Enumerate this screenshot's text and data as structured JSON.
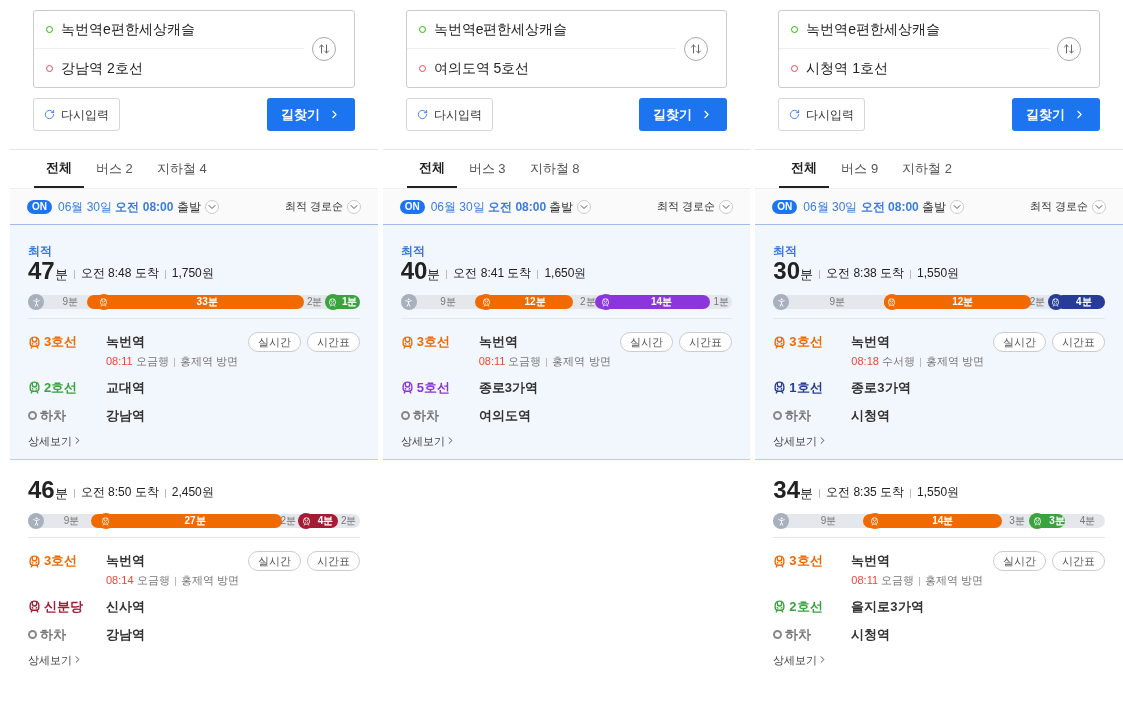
{
  "panels": [
    {
      "origin": "녹번역e편한세상캐슬",
      "destination": "강남역 2호선",
      "reset": "다시입력",
      "search": "길찾기",
      "tabs": [
        {
          "label": "전체",
          "selected": true
        },
        {
          "label": "버스 2",
          "selected": false
        },
        {
          "label": "지하철 4",
          "selected": false
        }
      ],
      "filter": {
        "badge": "ON",
        "date": "06월 30일",
        "time": "오전 08:00",
        "suffix": "출발",
        "sort": "최적 경로순"
      },
      "routes": [
        {
          "selected": true,
          "badge": "최적",
          "minutes": "47",
          "unit": "분",
          "arrival": "오전 8:48 도착",
          "fare": "1,750원",
          "segments": [
            {
              "kind": "walk",
              "label": "9분"
            },
            {
              "kind": "ride",
              "color": "#f06a00",
              "label": "33분"
            },
            {
              "kind": "walk",
              "label": "2분"
            },
            {
              "kind": "ride",
              "color": "#3aa33e",
              "label": "1분"
            }
          ],
          "steps": [
            {
              "kind": "ride",
              "color": "#f06a00",
              "line": "3호선",
              "station": "녹번역",
              "buttons": [
                "실시간",
                "시간표"
              ],
              "time": "08:11",
              "bound": "오금행",
              "direction": "홍제역 방면"
            },
            {
              "kind": "ride",
              "color": "#3aa33e",
              "line": "2호선",
              "station": "교대역"
            },
            {
              "kind": "alight",
              "line": "하차",
              "station": "강남역"
            }
          ],
          "more": "상세보기"
        },
        {
          "selected": false,
          "minutes": "46",
          "unit": "분",
          "arrival": "오전 8:50 도착",
          "fare": "2,450원",
          "segments": [
            {
              "kind": "walk",
              "label": "9분"
            },
            {
              "kind": "ride",
              "color": "#f06a00",
              "label": "27분"
            },
            {
              "kind": "walk",
              "label": "2분"
            },
            {
              "kind": "ride",
              "color": "#a31c34",
              "label": "4분"
            },
            {
              "kind": "walk",
              "label": "2분"
            }
          ],
          "steps": [
            {
              "kind": "ride",
              "color": "#f06a00",
              "line": "3호선",
              "station": "녹번역",
              "buttons": [
                "실시간",
                "시간표"
              ],
              "time": "08:14",
              "bound": "오금행",
              "direction": "홍제역 방면"
            },
            {
              "kind": "ride",
              "color": "#a31c34",
              "line": "신분당",
              "station": "신사역"
            },
            {
              "kind": "alight",
              "line": "하차",
              "station": "강남역"
            }
          ],
          "more": "상세보기"
        }
      ]
    },
    {
      "origin": "녹번역e편한세상캐슬",
      "destination": "여의도역 5호선",
      "reset": "다시입력",
      "search": "길찾기",
      "tabs": [
        {
          "label": "전체",
          "selected": true
        },
        {
          "label": "버스 3",
          "selected": false
        },
        {
          "label": "지하철 8",
          "selected": false
        }
      ],
      "filter": {
        "badge": "ON",
        "date": "06월 30일",
        "time": "오전 08:00",
        "suffix": "출발",
        "sort": "최적 경로순"
      },
      "routes": [
        {
          "selected": true,
          "badge": "최적",
          "minutes": "40",
          "unit": "분",
          "arrival": "오전 8:41 도착",
          "fare": "1,650원",
          "segments": [
            {
              "kind": "walk",
              "label": "9분"
            },
            {
              "kind": "ride",
              "color": "#f06a00",
              "label": "12분"
            },
            {
              "kind": "walk",
              "label": "2분"
            },
            {
              "kind": "ride",
              "color": "#8a36dc",
              "label": "14분"
            },
            {
              "kind": "walk",
              "label": "1분"
            }
          ],
          "steps": [
            {
              "kind": "ride",
              "color": "#f06a00",
              "line": "3호선",
              "station": "녹번역",
              "buttons": [
                "실시간",
                "시간표"
              ],
              "time": "08:11",
              "bound": "오금행",
              "direction": "홍제역 방면"
            },
            {
              "kind": "ride",
              "color": "#8a36dc",
              "line": "5호선",
              "station": "종로3가역"
            },
            {
              "kind": "alight",
              "line": "하차",
              "station": "여의도역"
            }
          ],
          "more": "상세보기"
        }
      ]
    },
    {
      "origin": "녹번역e편한세상캐슬",
      "destination": "시청역 1호선",
      "reset": "다시입력",
      "search": "길찾기",
      "tabs": [
        {
          "label": "전체",
          "selected": true
        },
        {
          "label": "버스 9",
          "selected": false
        },
        {
          "label": "지하철 2",
          "selected": false
        }
      ],
      "filter": {
        "badge": "ON",
        "date": "06월 30일",
        "time": "오전 08:00",
        "suffix": "출발",
        "sort": "최적 경로순"
      },
      "routes": [
        {
          "selected": true,
          "badge": "최적",
          "minutes": "30",
          "unit": "분",
          "arrival": "오전 8:38 도착",
          "fare": "1,550원",
          "segments": [
            {
              "kind": "walk",
              "label": "9분"
            },
            {
              "kind": "ride",
              "color": "#f06a00",
              "label": "12분"
            },
            {
              "kind": "walk",
              "label": "2분"
            },
            {
              "kind": "ride",
              "color": "#263c96",
              "label": "4분"
            }
          ],
          "steps": [
            {
              "kind": "ride",
              "color": "#f06a00",
              "line": "3호선",
              "station": "녹번역",
              "buttons": [
                "실시간",
                "시간표"
              ],
              "time": "08:18",
              "bound": "수서행",
              "direction": "홍제역 방면"
            },
            {
              "kind": "ride",
              "color": "#263c96",
              "line": "1호선",
              "station": "종로3가역"
            },
            {
              "kind": "alight",
              "line": "하차",
              "station": "시청역"
            }
          ],
          "more": "상세보기"
        },
        {
          "selected": false,
          "minutes": "34",
          "unit": "분",
          "arrival": "오전 8:35 도착",
          "fare": "1,550원",
          "segments": [
            {
              "kind": "walk",
              "label": "9분"
            },
            {
              "kind": "ride",
              "color": "#f06a00",
              "label": "14분"
            },
            {
              "kind": "walk",
              "label": "3분"
            },
            {
              "kind": "ride",
              "color": "#3aa33e",
              "label": "3분"
            },
            {
              "kind": "walk",
              "label": "4분"
            }
          ],
          "steps": [
            {
              "kind": "ride",
              "color": "#f06a00",
              "line": "3호선",
              "station": "녹번역",
              "buttons": [
                "실시간",
                "시간표"
              ],
              "time": "08:11",
              "bound": "오금행",
              "direction": "홍제역 방면"
            },
            {
              "kind": "ride",
              "color": "#3aa33e",
              "line": "2호선",
              "station": "을지로3가역"
            },
            {
              "kind": "alight",
              "line": "하차",
              "station": "시청역"
            }
          ],
          "more": "상세보기"
        }
      ]
    }
  ]
}
